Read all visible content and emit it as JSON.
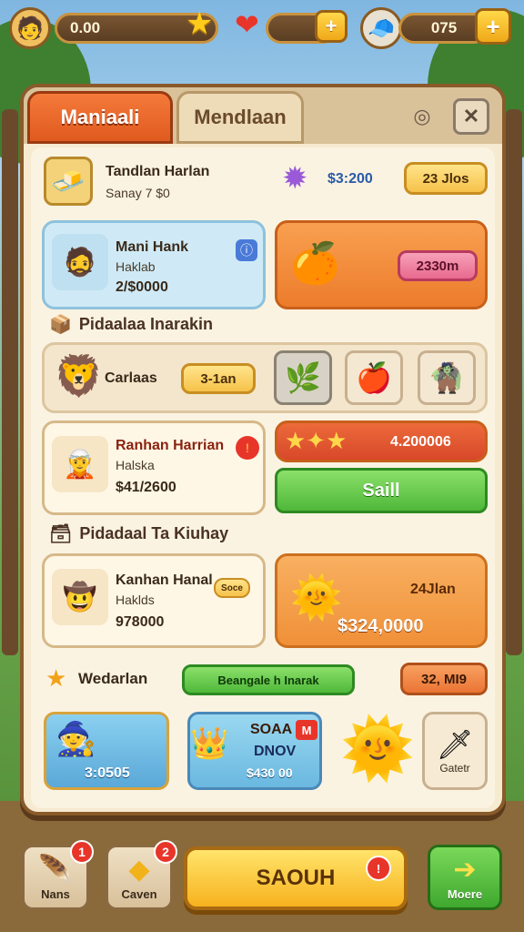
{
  "topbar": {
    "coins_value": "0.00",
    "gems_value": "075",
    "plus_label": "+"
  },
  "tabs": {
    "active": "Maniaali",
    "inactive": "Mendlaan"
  },
  "offer1": {
    "title": "Tandlan Harlan",
    "subtitle": "Sanay 7 $0",
    "price": "$3:200",
    "button": "23 Jlos"
  },
  "hero1": {
    "name": "Mani Hank",
    "role": "Haklab",
    "cost": "2/$0000",
    "info_icon": "ⓘ"
  },
  "fruit_offer": {
    "button": "2330m"
  },
  "section1": {
    "title": "Pidaalaa Inarakin"
  },
  "cat_row": {
    "label": "Carlaas",
    "button": "3-1an"
  },
  "hero2": {
    "name": "Ranhan Harrian",
    "role": "Halska",
    "cost": "$41/2600"
  },
  "stars_offer": {
    "price": "4.200006",
    "button": "Saill"
  },
  "section2": {
    "title": "Pidadaal Ta Kiuhay"
  },
  "hero3": {
    "name": "Kanhan Hanal",
    "role": "Haklds",
    "cost": "978000",
    "tag": "Soce"
  },
  "sun_offer": {
    "label": "24Jlan",
    "price": "$324,0000"
  },
  "promo": {
    "label": "Wedarlan",
    "bar": "Beangale h Inarak",
    "price": "32, MI9"
  },
  "bottom_tiles": {
    "tile1_price": "3:0505",
    "tile2_title": "SOAA",
    "tile2_badge": "M",
    "tile2_sub": "DNOV",
    "tile2_price": "$430 00",
    "tile4_label": "Gatetr"
  },
  "nav": {
    "btn1_label": "Nans",
    "btn1_badge": "1",
    "btn2_label": "Caven",
    "btn2_badge": "2",
    "cta_label": "SAOUH",
    "more_label": "Moere"
  }
}
